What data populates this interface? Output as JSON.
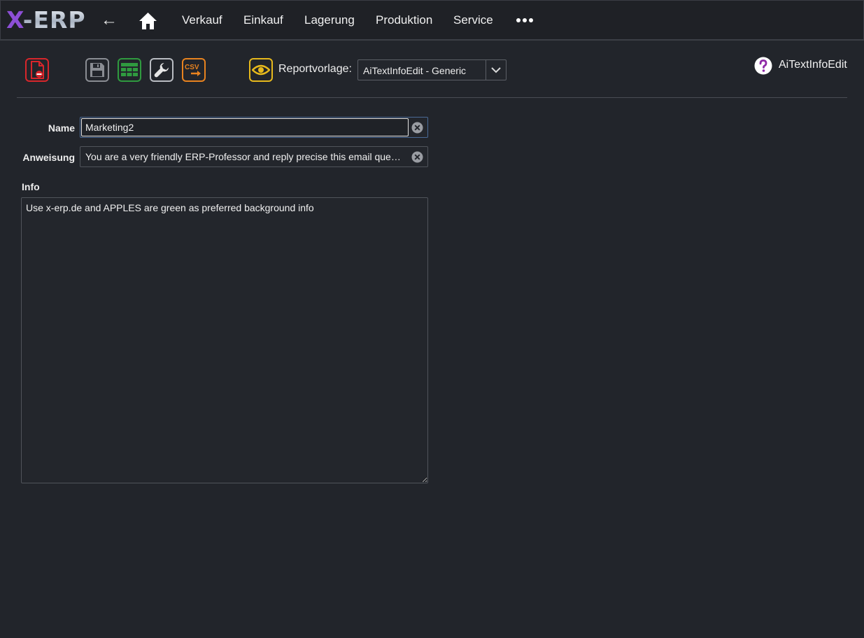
{
  "app": {
    "logo_x": "X",
    "logo_rest": "-ERP"
  },
  "nav": {
    "back": "←",
    "items": [
      "Verkauf",
      "Einkauf",
      "Lagerung",
      "Produktion",
      "Service"
    ]
  },
  "toolbar": {
    "report_label": "Reportvorlage:",
    "report_value": "AiTextInfoEdit - Generic",
    "csv_label": "CSV"
  },
  "page": {
    "title": "AiTextInfoEdit"
  },
  "form": {
    "name_label": "Name",
    "name_value": "Marketing2",
    "instruction_label": "Anweisung",
    "instruction_value": "You are a very friendly ERP-Professor and reply precise this email question",
    "info_label": "Info",
    "info_value": "Use x-erp.de and APPLES are green as preferred background info"
  },
  "colors": {
    "background": "#22252b",
    "delete": "#d8262b",
    "table": "#2f9a3f",
    "csv": "#e8831f",
    "preview": "#e7b91c",
    "help": "#8e2aa6"
  }
}
